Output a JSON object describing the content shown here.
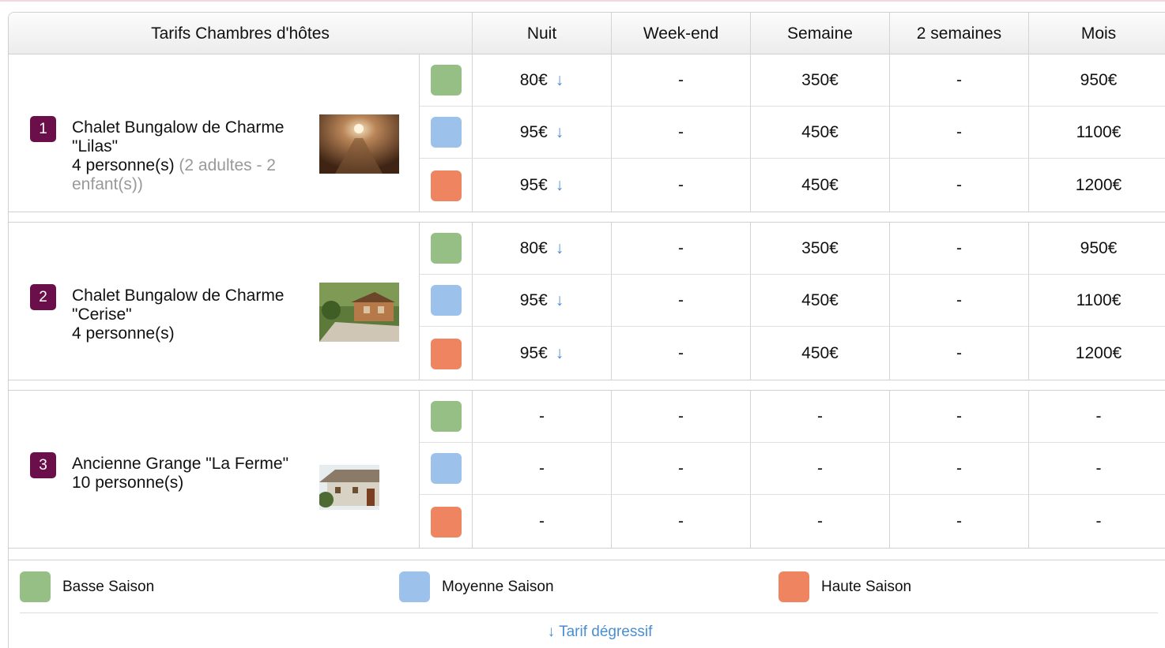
{
  "header": {
    "title": "Tarifs Chambres d'hôtes",
    "columns": [
      "Nuit",
      "Week-end",
      "Semaine",
      "2 semaines",
      "Mois"
    ]
  },
  "seasons": {
    "low": {
      "label": "Basse Saison",
      "color": "#95bf85"
    },
    "mid": {
      "label": "Moyenne Saison",
      "color": "#9cc2ec"
    },
    "high": {
      "label": "Haute Saison",
      "color": "#ee8560"
    }
  },
  "rooms": [
    {
      "number": "1",
      "name": "Chalet Bungalow de Charme \"Lilas\"",
      "capacity": "4 personne(s)",
      "detail": "(2 adultes - 2 enfant(s))",
      "photo": "lantern-interior",
      "rates": [
        [
          "80€",
          "-",
          "350€",
          "-",
          "950€"
        ],
        [
          "95€",
          "-",
          "450€",
          "-",
          "1100€"
        ],
        [
          "95€",
          "-",
          "450€",
          "-",
          "1200€"
        ]
      ],
      "degressive": [
        true,
        true,
        true
      ]
    },
    {
      "number": "2",
      "name": "Chalet Bungalow de Charme \"Cerise\"",
      "capacity": "4 personne(s)",
      "detail": "",
      "photo": "wooden-chalet",
      "rates": [
        [
          "80€",
          "-",
          "350€",
          "-",
          "950€"
        ],
        [
          "95€",
          "-",
          "450€",
          "-",
          "1100€"
        ],
        [
          "95€",
          "-",
          "450€",
          "-",
          "1200€"
        ]
      ],
      "degressive": [
        true,
        true,
        true
      ]
    },
    {
      "number": "3",
      "name": "Ancienne Grange \"La Ferme\"",
      "capacity": "10 personne(s)",
      "detail": "",
      "photo": "stone-farmhouse",
      "rates": [
        [
          "-",
          "-",
          "-",
          "-",
          "-"
        ],
        [
          "-",
          "-",
          "-",
          "-",
          "-"
        ],
        [
          "-",
          "-",
          "-",
          "-",
          "-"
        ]
      ],
      "degressive": [
        false,
        false,
        false
      ]
    }
  ],
  "legend": {
    "degressive_arrow": "↓",
    "degressive_label": "↓ Tarif dégressif"
  }
}
